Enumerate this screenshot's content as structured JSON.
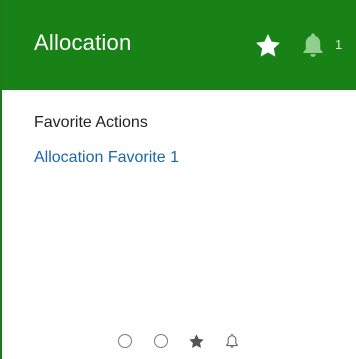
{
  "card": {
    "title": "Allocation",
    "bell_count": "1",
    "section_label": "Favorite Actions",
    "favorites": [
      "Allocation Favorite 1"
    ]
  },
  "icons": {
    "header_star": "star-icon",
    "header_bell": "bell-icon",
    "pager": [
      "circle-icon",
      "circle-icon",
      "star-icon",
      "bell-icon"
    ]
  },
  "colors": {
    "header_bg": "#188217",
    "link": "#1a66b3",
    "bell_muted": "#8fd08f"
  }
}
